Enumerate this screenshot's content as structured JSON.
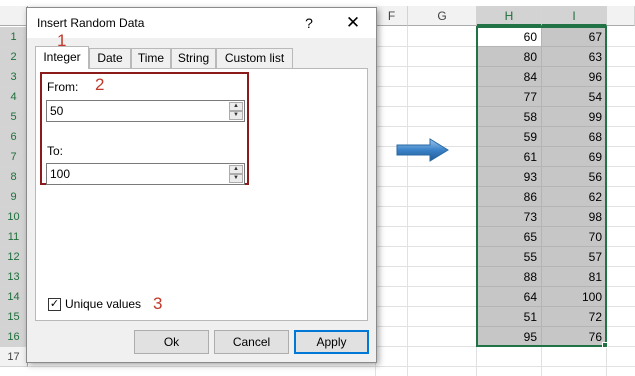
{
  "sheet": {
    "columns": [
      "F",
      "G",
      "H",
      "I"
    ],
    "rows": [
      "1",
      "2",
      "3",
      "4",
      "5",
      "6",
      "7",
      "8",
      "9",
      "10",
      "11",
      "12",
      "13",
      "14",
      "15",
      "16",
      "17"
    ],
    "col_h_values": [
      "60",
      "80",
      "84",
      "77",
      "58",
      "59",
      "61",
      "93",
      "86",
      "73",
      "65",
      "55",
      "88",
      "64",
      "51",
      "95"
    ],
    "col_i_values": [
      "67",
      "63",
      "96",
      "54",
      "99",
      "68",
      "69",
      "56",
      "62",
      "98",
      "70",
      "57",
      "81",
      "100",
      "72",
      "76"
    ],
    "colors": {
      "selection": "#217346",
      "shade": "#c6c6c6",
      "arrow": "#2e75b6"
    }
  },
  "dialog": {
    "title": "Insert Random Data",
    "help_glyph": "?",
    "close_glyph": "✕",
    "tabs": [
      "Integer",
      "Date",
      "Time",
      "String",
      "Custom list"
    ],
    "active_tab": "Integer",
    "from_label": "From:",
    "from_value": "50",
    "to_label": "To:",
    "to_value": "100",
    "unique_label": "Unique values",
    "unique_checked": true,
    "unique_check_glyph": "✓",
    "spin_up_glyph": "▲",
    "spin_down_glyph": "▼",
    "buttons": {
      "ok": "Ok",
      "cancel": "Cancel",
      "apply": "Apply"
    },
    "colors": {
      "range_box": "#8b1a1a",
      "default_button": "#0078d7"
    }
  },
  "callouts": [
    "1",
    "2",
    "3"
  ],
  "icons": {
    "arrow": "arrow-right-icon"
  }
}
